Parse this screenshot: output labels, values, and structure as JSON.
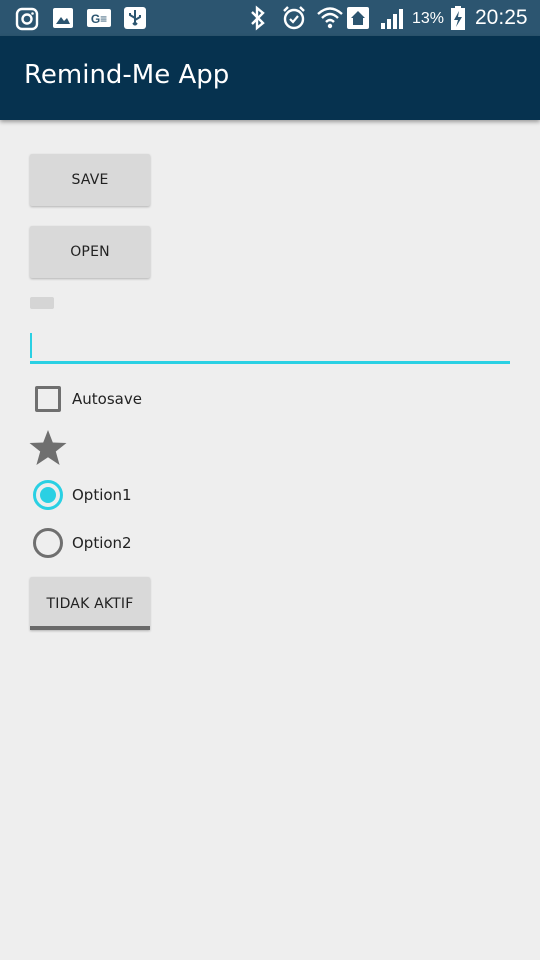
{
  "status_bar": {
    "battery": "13%",
    "time": "20:25",
    "icons": [
      "instagram-icon",
      "gallery-icon",
      "ge-icon",
      "usb-icon",
      "bluetooth-icon",
      "alarm-icon",
      "wifi-icon",
      "home-icon",
      "signal-icon",
      "battery-icon"
    ]
  },
  "app_bar": {
    "title": "Remind-Me App"
  },
  "buttons": {
    "save": "SAVE",
    "open": "OPEN"
  },
  "edit_text": {
    "value": ""
  },
  "checkbox": {
    "label": "Autosave",
    "checked": false
  },
  "rating": {
    "stars": 1,
    "icon": "star-icon"
  },
  "radio_group": {
    "options": [
      {
        "label": "Option1",
        "checked": true
      },
      {
        "label": "Option2",
        "checked": false
      }
    ]
  },
  "toggle_button": {
    "label": "TIDAK AKTIF"
  },
  "colors": {
    "accent": "#2ad0e3",
    "app_bar": "#06324f",
    "status_bar": "#2c5570",
    "background": "#eeeeee"
  }
}
